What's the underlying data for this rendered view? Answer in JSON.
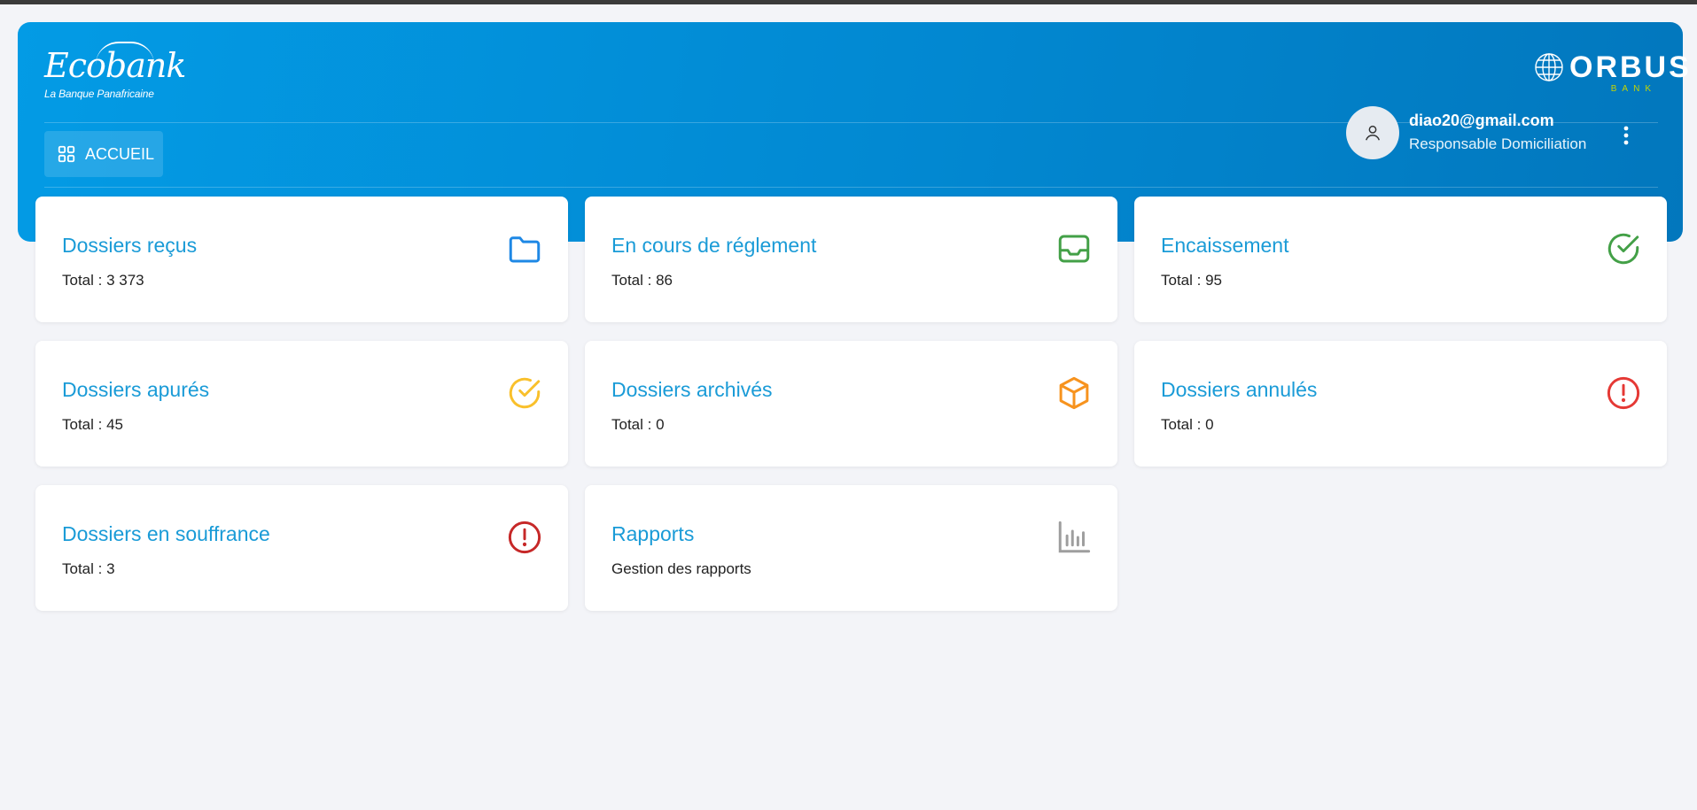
{
  "header": {
    "brand_left": {
      "name": "Ecobank",
      "tagline": "La Banque Panafricaine"
    },
    "brand_right": {
      "name": "ORBUS",
      "sub": "BANK"
    },
    "nav": {
      "home_label": "ACCUEIL",
      "home_icon": "grid-icon"
    },
    "user": {
      "email": "diao20@gmail.com",
      "role": "Responsable Domiciliation",
      "avatar_icon": "user-icon",
      "menu_icon": "more-vertical-icon"
    }
  },
  "cards": [
    {
      "title": "Dossiers reçus",
      "subtitle": "Total : 3 373",
      "icon": "folder-icon",
      "color": "#1e88e5"
    },
    {
      "title": "En cours de réglement",
      "subtitle": "Total : 86",
      "icon": "inbox-icon",
      "color": "#43a047"
    },
    {
      "title": "Encaissement",
      "subtitle": "Total : 95",
      "icon": "check-circle-icon",
      "color": "#43a047"
    },
    {
      "title": "Dossiers apurés",
      "subtitle": "Total : 45",
      "icon": "check-circle-icon",
      "color": "#f9c02b"
    },
    {
      "title": "Dossiers archivés",
      "subtitle": "Total : 0",
      "icon": "box-icon",
      "color": "#f7931e"
    },
    {
      "title": "Dossiers annulés",
      "subtitle": "Total : 0",
      "icon": "alert-circle-icon",
      "color": "#e53935"
    },
    {
      "title": "Dossiers en souffrance",
      "subtitle": "Total : 3",
      "icon": "alert-circle-icon",
      "color": "#c62828"
    },
    {
      "title": "Rapports",
      "subtitle": "Gestion des rapports",
      "icon": "bar-chart-icon",
      "color": "#9e9e9e"
    }
  ],
  "colors": {
    "header_start": "#039be5",
    "header_end": "#0277bd",
    "title_text": "#1a9bd7",
    "background": "#f3f4f8"
  }
}
